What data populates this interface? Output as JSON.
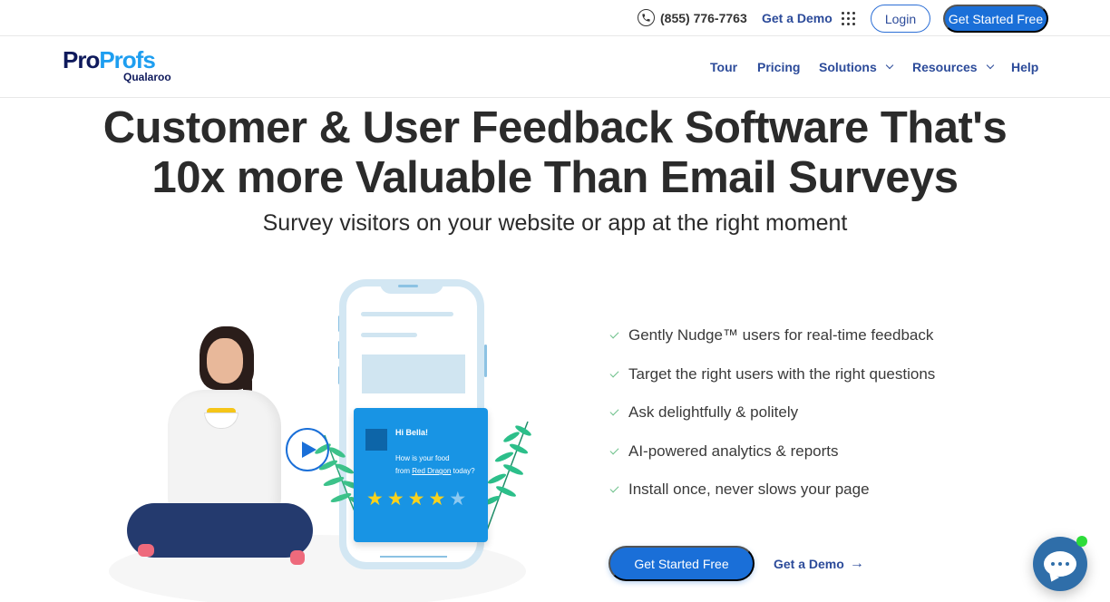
{
  "topbar": {
    "phone_icon": "phone-icon",
    "phone": "(855) 776-7763",
    "demo_link": "Get a Demo",
    "apps_icon": "apps-grid-icon",
    "login": "Login",
    "get_started": "Get Started Free"
  },
  "logo": {
    "brand_part1": "Pro",
    "brand_part2": "Profs",
    "product": "Qualaroo"
  },
  "nav": {
    "items": [
      {
        "label": "Tour",
        "dropdown": false
      },
      {
        "label": "Pricing",
        "dropdown": false
      },
      {
        "label": "Solutions",
        "dropdown": true
      },
      {
        "label": "Resources",
        "dropdown": true
      },
      {
        "label": "Help",
        "dropdown": false
      }
    ]
  },
  "hero": {
    "headline_line1": "Customer & User Feedback Software That's",
    "headline_line2": "10x more Valuable Than Email Surveys",
    "subheadline": "Survey visitors on your website or app at the right moment"
  },
  "features": [
    "Gently Nudge™ users for real-time feedback",
    "Target the right users with the right questions",
    "Ask delightfully & politely",
    "AI-powered analytics & reports",
    "Install once, never slows your page"
  ],
  "cta": {
    "primary": "Get Started Free",
    "secondary": "Get a Demo",
    "secondary_arrow": "→"
  },
  "illustration": {
    "card_greeting": "Hi Bella!",
    "card_question_prefix": "How is your food",
    "card_question_from": "from",
    "card_question_brand": "Red Dragon",
    "card_question_suffix": "today?",
    "rating": 4,
    "rating_max": 5,
    "play_icon": "play-icon"
  },
  "chat_widget": {
    "icon": "chat-bubble-icon",
    "status": "online"
  },
  "colors": {
    "primary_blue": "#1a6fd8",
    "nav_text": "#2c4b9a",
    "logo_dark": "#0f1a5c",
    "logo_light": "#1e9ef0",
    "check_green": "#6cc08a",
    "card_blue": "#1894e4",
    "star_yellow": "#f8d21c",
    "chat_blue": "#2f6ea9",
    "online_green": "#2ddc3a"
  }
}
